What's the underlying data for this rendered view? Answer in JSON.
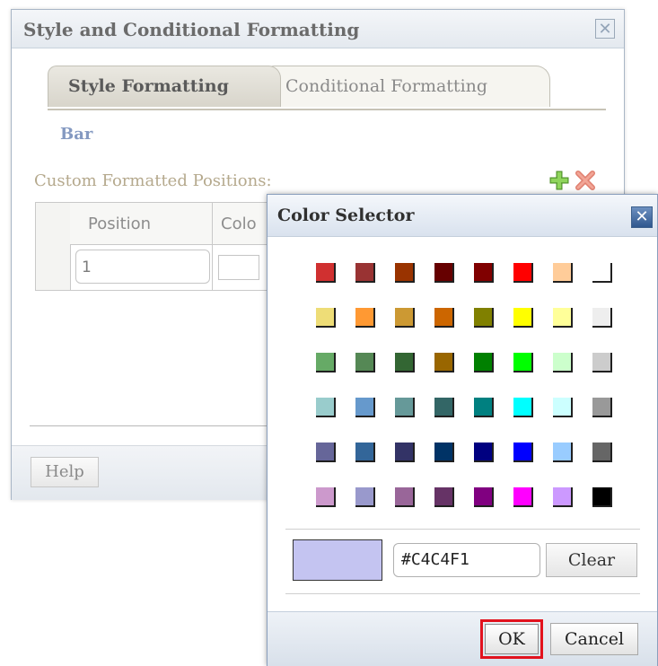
{
  "main_dialog": {
    "title": "Style and Conditional Formatting",
    "tabs": [
      {
        "label": "Style Formatting",
        "active": true
      },
      {
        "label": "Conditional Formatting",
        "active": false
      }
    ],
    "section_title": "Bar",
    "custom_positions_label": "Custom Formatted Positions:",
    "table": {
      "headers": [
        "Position",
        "Colo"
      ],
      "rows": [
        {
          "position": "1"
        }
      ]
    },
    "help_label": "Help"
  },
  "color_selector": {
    "title": "Color Selector",
    "palette": [
      [
        "#d03030",
        "#993333",
        "#993300",
        "#660000",
        "#800000",
        "#ff0000",
        "#ffcc99",
        "#ffffff"
      ],
      [
        "#eedd77",
        "#ff9933",
        "#cc9933",
        "#cc6600",
        "#808000",
        "#ffff00",
        "#ffff99",
        "#eeeeee"
      ],
      [
        "#66aa66",
        "#558855",
        "#336633",
        "#996600",
        "#008000",
        "#00ff00",
        "#ccffcc",
        "#cccccc"
      ],
      [
        "#99cccc",
        "#6699cc",
        "#669999",
        "#336666",
        "#008080",
        "#00ffff",
        "#ccffff",
        "#999999"
      ],
      [
        "#666699",
        "#336699",
        "#333366",
        "#003366",
        "#000080",
        "#0000ff",
        "#99ccff",
        "#666666"
      ],
      [
        "#cc99cc",
        "#9999cc",
        "#996699",
        "#663366",
        "#800080",
        "#ff00ff",
        "#cc99ff",
        "#000000"
      ]
    ],
    "selected_color": "#C4C4F1",
    "hex_value": "#C4C4F1",
    "clear_label": "Clear",
    "ok_label": "OK",
    "cancel_label": "Cancel"
  }
}
